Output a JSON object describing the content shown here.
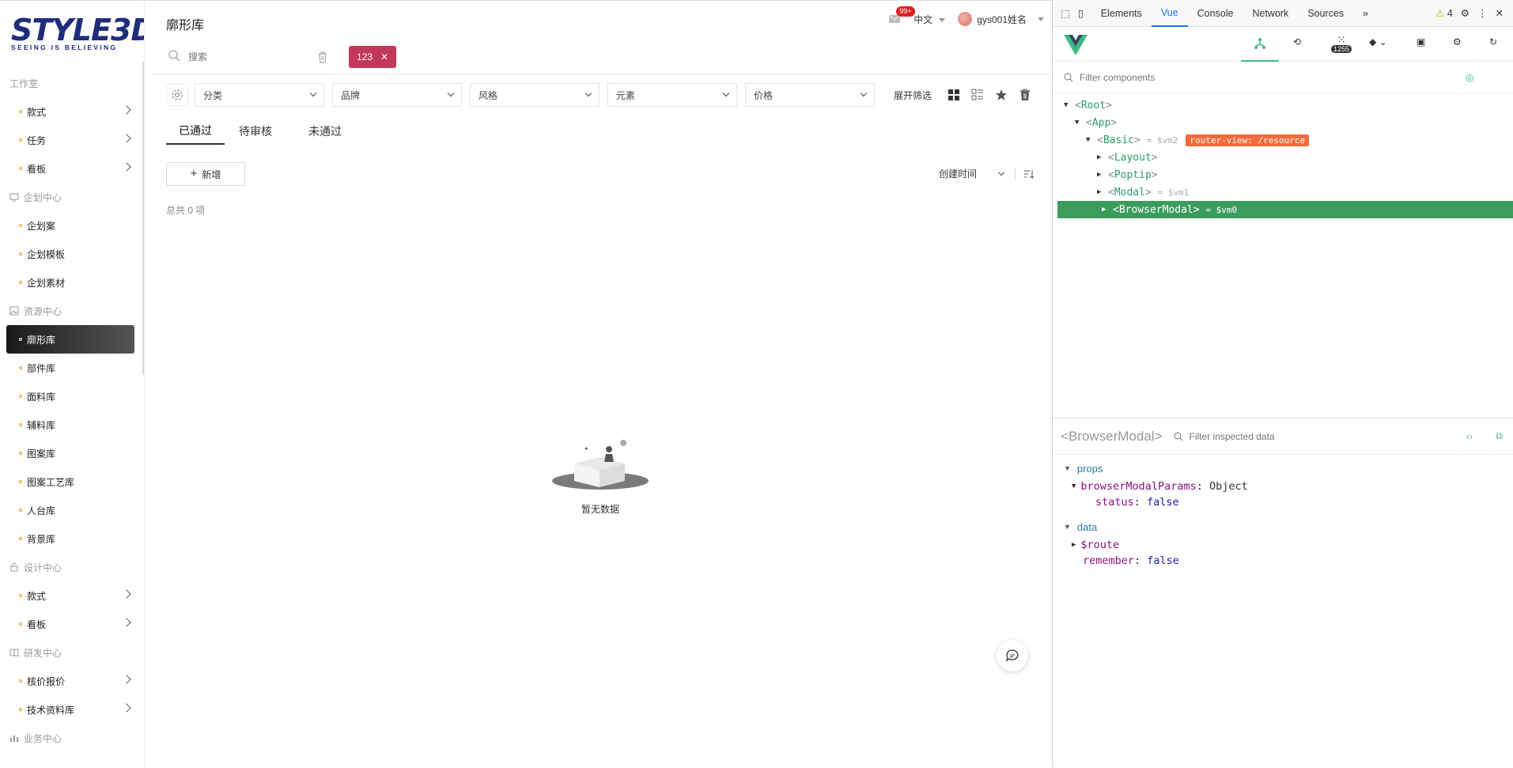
{
  "sidebar": {
    "logo_text": "STYLE3D",
    "logo_sub": "SEEING IS BELIEVING",
    "groups": [
      {
        "label": "工作室",
        "items": [
          "款式",
          "任务",
          "看板"
        ]
      },
      {
        "label": "企划中心",
        "items": [
          "企划案",
          "企划模板",
          "企划素材"
        ]
      },
      {
        "label": "资源中心",
        "items": [
          "廓形库",
          "部件库",
          "面料库",
          "辅料库",
          "图案库",
          "图案工艺库",
          "人台库",
          "背景库"
        ]
      },
      {
        "label": "设计中心",
        "items": [
          "款式",
          "看板"
        ]
      },
      {
        "label": "研发中心",
        "items": [
          "核价报价",
          "技术资料库"
        ]
      },
      {
        "label": "业务中心",
        "items": []
      }
    ],
    "active_item": "廓形库"
  },
  "header": {
    "title": "廓形库",
    "badge": "99+",
    "language": "中文",
    "username": "gys001姓名"
  },
  "search": {
    "placeholder": "搜索",
    "tag": "123"
  },
  "filters": {
    "selects": [
      "分类",
      "品牌",
      "风格",
      "元素",
      "价格"
    ],
    "expand_label": "展开筛选"
  },
  "tabs": [
    "已通过",
    "待审核",
    "未通过"
  ],
  "toolbar": {
    "add_label": "新增",
    "sort_label": "创建时间"
  },
  "total_label": "总共 0 项",
  "empty_text": "暂无数据",
  "devtools": {
    "tabs": [
      "Elements",
      "Vue",
      "Console",
      "Network",
      "Sources",
      "»"
    ],
    "warning_count": "4",
    "perf_count": "1255",
    "filter_placeholder": "Filter components",
    "tree": [
      {
        "name": "Root",
        "depth": 0
      },
      {
        "name": "App",
        "depth": 1
      },
      {
        "name": "Basic",
        "depth": 2,
        "vm": "= $vm2",
        "route": "router-view: /resource"
      },
      {
        "name": "Layout",
        "depth": 3
      },
      {
        "name": "Poptip",
        "depth": 3
      },
      {
        "name": "Modal",
        "depth": 3,
        "vm": "= $vm1"
      },
      {
        "name": "BrowserModal",
        "depth": 3,
        "vm": "= $vm0",
        "selected": true
      }
    ],
    "inspector": {
      "component": "BrowserModal",
      "filter_placeholder": "Filter inspected data",
      "props_label": "props",
      "prop_key": "browserModalParams",
      "prop_type": "Object",
      "status_key": "status",
      "status_val": "false",
      "data_label": "data",
      "route_key": "$route",
      "remember_key": "remember",
      "remember_val": "false"
    }
  },
  "colors": {
    "accent": "#c3385a",
    "vue_green": "#3b9c5e",
    "route_badge": "#f26b3a"
  }
}
